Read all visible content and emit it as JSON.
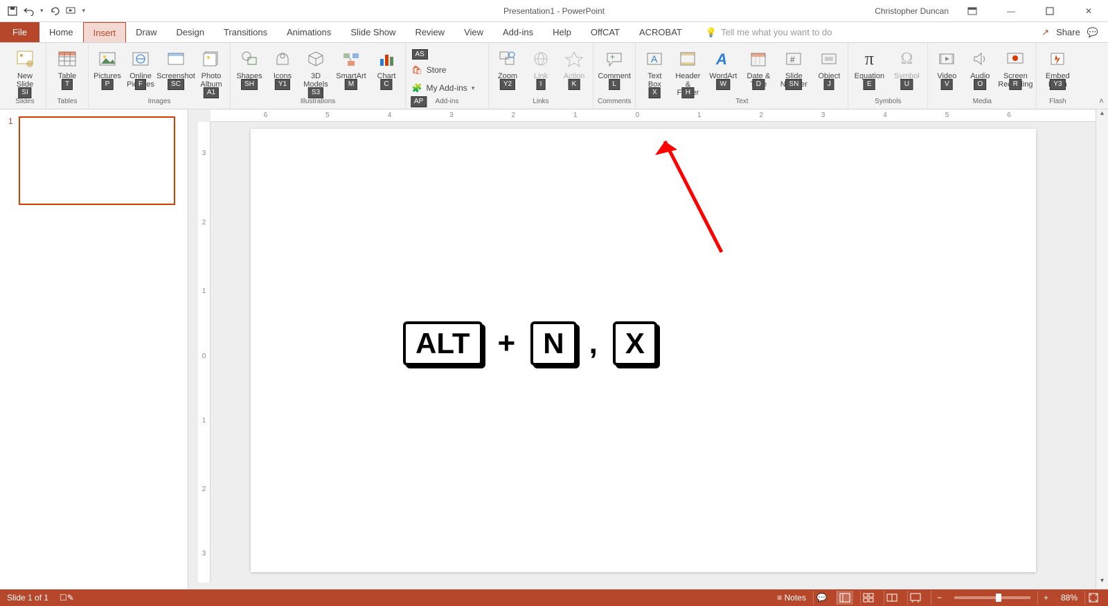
{
  "title": "Presentation1 - PowerPoint",
  "user": "Christopher Duncan",
  "menu": {
    "file": "File",
    "tabs": [
      "Home",
      "Insert",
      "Draw",
      "Design",
      "Transitions",
      "Animations",
      "Slide Show",
      "Review",
      "View",
      "Add-ins",
      "Help",
      "OffCAT",
      "ACROBAT"
    ],
    "active_index": 1,
    "tellme_placeholder": "Tell me what you want to do",
    "share": "Share"
  },
  "ribbon": {
    "groups": {
      "slides": {
        "label": "Slides",
        "items": {
          "new_slide": "New Slide"
        },
        "keys": {
          "new_slide": "SI"
        }
      },
      "tables": {
        "label": "Tables",
        "items": {
          "table": "Table"
        },
        "keys": {
          "table": "T"
        }
      },
      "images": {
        "label": "Images",
        "items": {
          "pictures": "Pictures",
          "online_pictures": "Online Pictures",
          "screenshot": "Screenshot",
          "photo_album": "Photo Album"
        },
        "keys": {
          "pictures": "P",
          "online_pictures": "F",
          "screenshot": "SC",
          "photo_album": "A1"
        }
      },
      "illustrations": {
        "label": "Illustrations",
        "items": {
          "shapes": "Shapes",
          "icons": "Icons",
          "models": "3D Models",
          "smartart": "SmartArt",
          "chart": "Chart"
        },
        "keys": {
          "shapes": "SH",
          "icons": "Y1",
          "models": "S3",
          "smartart": "M",
          "chart": "C"
        }
      },
      "addins": {
        "label": "Add-ins",
        "store": "Store",
        "my": "My Add-ins",
        "keys": {
          "store": "AS",
          "my": "AP"
        }
      },
      "links": {
        "label": "Links",
        "items": {
          "zoom": "Zoom",
          "link": "Link",
          "action": "Action"
        },
        "keys": {
          "zoom": "Y2",
          "link": "I",
          "action": "K"
        }
      },
      "comments": {
        "label": "Comments",
        "items": {
          "comment": "Comment"
        },
        "keys": {
          "comment": "L"
        }
      },
      "text": {
        "label": "Text",
        "items": {
          "text_box": "Text Box",
          "header": "Header & Footer",
          "wordart": "WordArt",
          "date": "Date & Time",
          "number": "Slide Number",
          "object": "Object"
        },
        "keys": {
          "text_box": "X",
          "header": "H",
          "wordart": "W",
          "date": "D",
          "number": "SN",
          "object": "J"
        }
      },
      "symbols": {
        "label": "Symbols",
        "items": {
          "equation": "Equation",
          "symbol": "Symbol"
        },
        "keys": {
          "equation": "E",
          "symbol": "U"
        }
      },
      "media": {
        "label": "Media",
        "items": {
          "video": "Video",
          "audio": "Audio",
          "screen": "Screen Recording"
        },
        "keys": {
          "video": "V",
          "audio": "O",
          "screen": "R"
        }
      },
      "flash": {
        "label": "Flash",
        "items": {
          "embed": "Embed Flash"
        },
        "keys": {
          "embed": "Y3"
        }
      }
    }
  },
  "panel": {
    "slide_number": "1"
  },
  "slide_content": {
    "keycombo": {
      "k1": "ALT",
      "plus": "+",
      "k2": "N",
      "comma": ",",
      "k3": "X"
    }
  },
  "ruler": {
    "hticks": [
      "6",
      "5",
      "4",
      "3",
      "2",
      "1",
      "0",
      "1",
      "2",
      "3",
      "4",
      "5",
      "6"
    ],
    "vticks": [
      "3",
      "2",
      "1",
      "0",
      "1",
      "2",
      "3"
    ]
  },
  "status": {
    "left": "Slide 1 of 1",
    "notes": "Notes",
    "comments_icon": "comments",
    "zoom": "88%"
  }
}
